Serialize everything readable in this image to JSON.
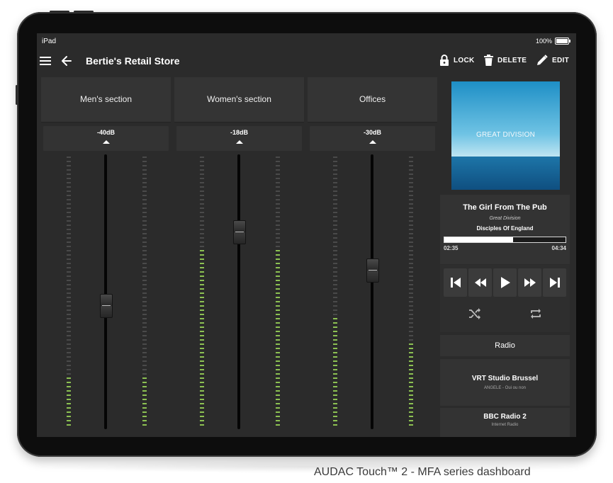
{
  "status": {
    "carrier": "iPad",
    "battery": "100%"
  },
  "appbar": {
    "title": "Bertie's Retail Store",
    "actions": {
      "lock": "LOCK",
      "delete": "DELETE",
      "edit": "EDIT"
    }
  },
  "channels": [
    {
      "name": "Men's section",
      "db": "-40dB",
      "fader_level": 0.45,
      "meter_left": 0.18,
      "meter_right": 0.18
    },
    {
      "name": "Women's section",
      "db": "-18dB",
      "fader_level": 0.72,
      "meter_left": 0.65,
      "meter_right": 0.65
    },
    {
      "name": "Offices",
      "db": "-30dB",
      "fader_level": 0.58,
      "meter_left": 0.4,
      "meter_right": 0.31
    }
  ],
  "album_art": {
    "text": "GREAT DIVISION"
  },
  "now_playing": {
    "title": "The Girl From The Pub",
    "album": "Great Division",
    "artist": "Disciples Of England",
    "elapsed": "02:35",
    "duration": "04:34",
    "progress": 0.566
  },
  "controls": {
    "icons": [
      "skip-previous-icon",
      "rewind-icon",
      "play-icon",
      "fast-forward-icon",
      "skip-next-icon",
      "shuffle-icon",
      "repeat-icon"
    ]
  },
  "radio": {
    "header": "Radio",
    "stations": [
      {
        "name": "VRT Studio Brussel",
        "subtitle": "ANGELE - Oui ou non"
      },
      {
        "name": "BBC Radio 2",
        "subtitle": "Internet Radio"
      }
    ]
  },
  "colors": {
    "background": "#2b2b2b",
    "panel": "#333333",
    "meter_active": "#8cc152",
    "meter_inactive": "#4a4a4a",
    "text": "#ffffff"
  },
  "caption": "AUDAC Touch™ 2 - MFA series dashboard"
}
